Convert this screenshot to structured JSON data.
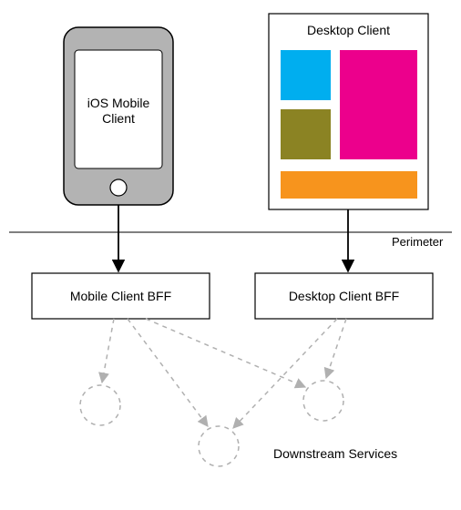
{
  "diagram": {
    "mobile_client_label": "iOS Mobile\nClient",
    "desktop_client_title": "Desktop Client",
    "perimeter_label": "Perimeter",
    "mobile_bff_label": "Mobile Client BFF",
    "desktop_bff_label": "Desktop Client BFF",
    "downstream_label": "Downstream Services",
    "colors": {
      "phone_body": "#b3b3b3",
      "phone_outline": "#000000",
      "screen_fill": "#ffffff",
      "box_stroke": "#000000",
      "blue_block": "#00aeef",
      "olive_block": "#8b8323",
      "magenta_block": "#ec008c",
      "orange_block": "#f7941d",
      "dashed": "#b0b0b0"
    }
  }
}
